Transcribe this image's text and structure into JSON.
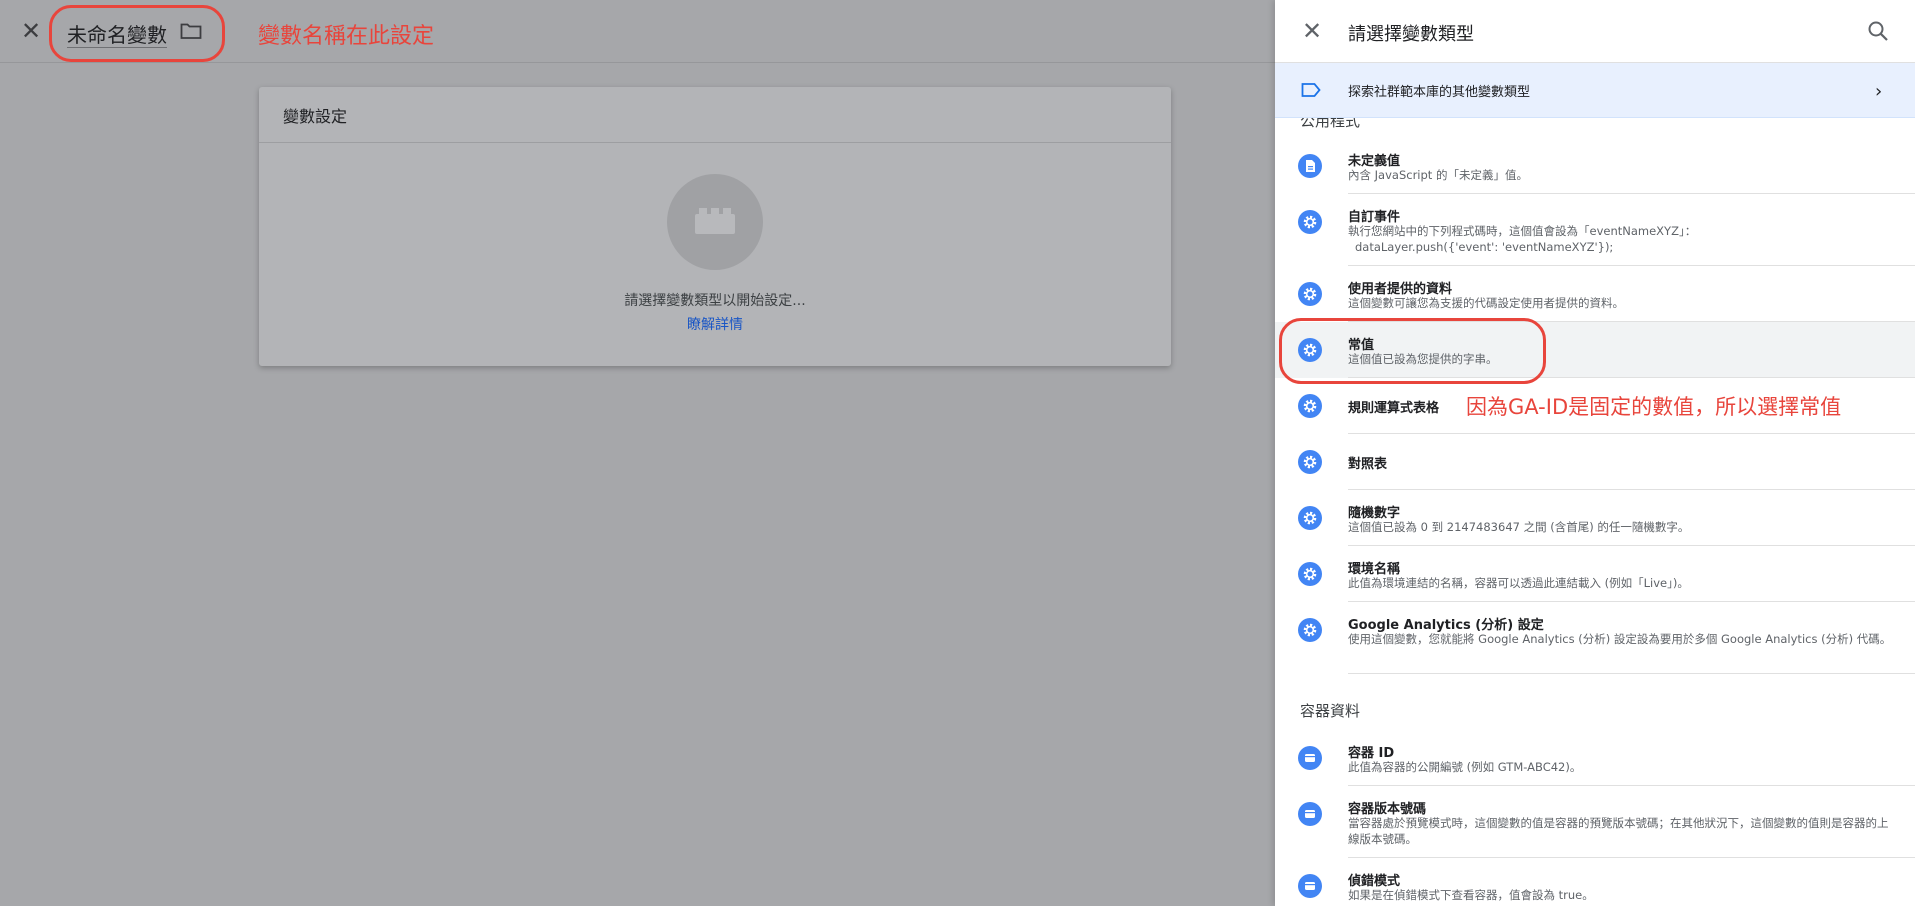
{
  "editor": {
    "variable_name": "未命名變數",
    "annotation": "變數名稱在此設定",
    "card_title": "變數設定",
    "card_message": "請選擇變數類型以開始設定...",
    "card_link": "瞭解詳情"
  },
  "panel": {
    "title": "請選擇變數類型",
    "community_label": "探索社群範本庫的其他變數類型",
    "section_cut": "公用程式",
    "items": [
      {
        "title": "未定義值",
        "desc": "內含 JavaScript 的「未定義」值。",
        "icon": "document-icon"
      },
      {
        "title": "自訂事件",
        "desc": "執行您網站中的下列程式碼時，這個值會設為「eventNameXYZ」：",
        "code": "dataLayer.push({'event': 'eventNameXYZ'});",
        "icon": "gear-icon"
      },
      {
        "title": "使用者提供的資料",
        "desc": "這個變數可讓您為支援的代碼設定使用者提供的資料。",
        "icon": "gear-icon"
      },
      {
        "title": "常值",
        "desc": "這個值已設為您提供的字串。",
        "icon": "gear-icon"
      },
      {
        "title": "規則運算式表格",
        "desc": "",
        "icon": "gear-icon"
      },
      {
        "title": "對照表",
        "desc": "",
        "icon": "gear-icon"
      },
      {
        "title": "隨機數字",
        "desc": "這個值已設為 0 到 2147483647 之間 (含首尾) 的任一隨機數字。",
        "icon": "gear-icon"
      },
      {
        "title": "環境名稱",
        "desc": "此值為環境連結的名稱，容器可以透過此連結載入 (例如「Live」)。",
        "icon": "gear-icon"
      },
      {
        "title": "Google Analytics (分析) 設定",
        "desc": "使用這個變數，您就能將 Google Analytics (分析) 設定設為要用於多個 Google Analytics (分析) 代碼。",
        "icon": "gear-icon"
      }
    ],
    "section_container": "容器資料",
    "container_items": [
      {
        "title": "容器 ID",
        "desc": "此值為容器的公開編號 (例如 GTM-ABC42)。",
        "icon": "container-icon"
      },
      {
        "title": "容器版本號碼",
        "desc": "當容器處於預覽模式時，這個變數的值是容器的預覽版本號碼；在其他狀況下，這個變數的值則是容器的上線版本號碼。",
        "icon": "container-icon"
      },
      {
        "title": "偵錯模式",
        "desc": "如果是在偵錯模式下查看容器，值會設為 true。",
        "icon": "container-icon"
      }
    ],
    "annotation": "因為GA-ID是固定的數值，所以選擇常值"
  },
  "colors": {
    "annotation": "#e8453c",
    "icon_blue": "#4285f4",
    "link_blue": "#1a56c5",
    "community_bg": "#e8f0fe"
  }
}
